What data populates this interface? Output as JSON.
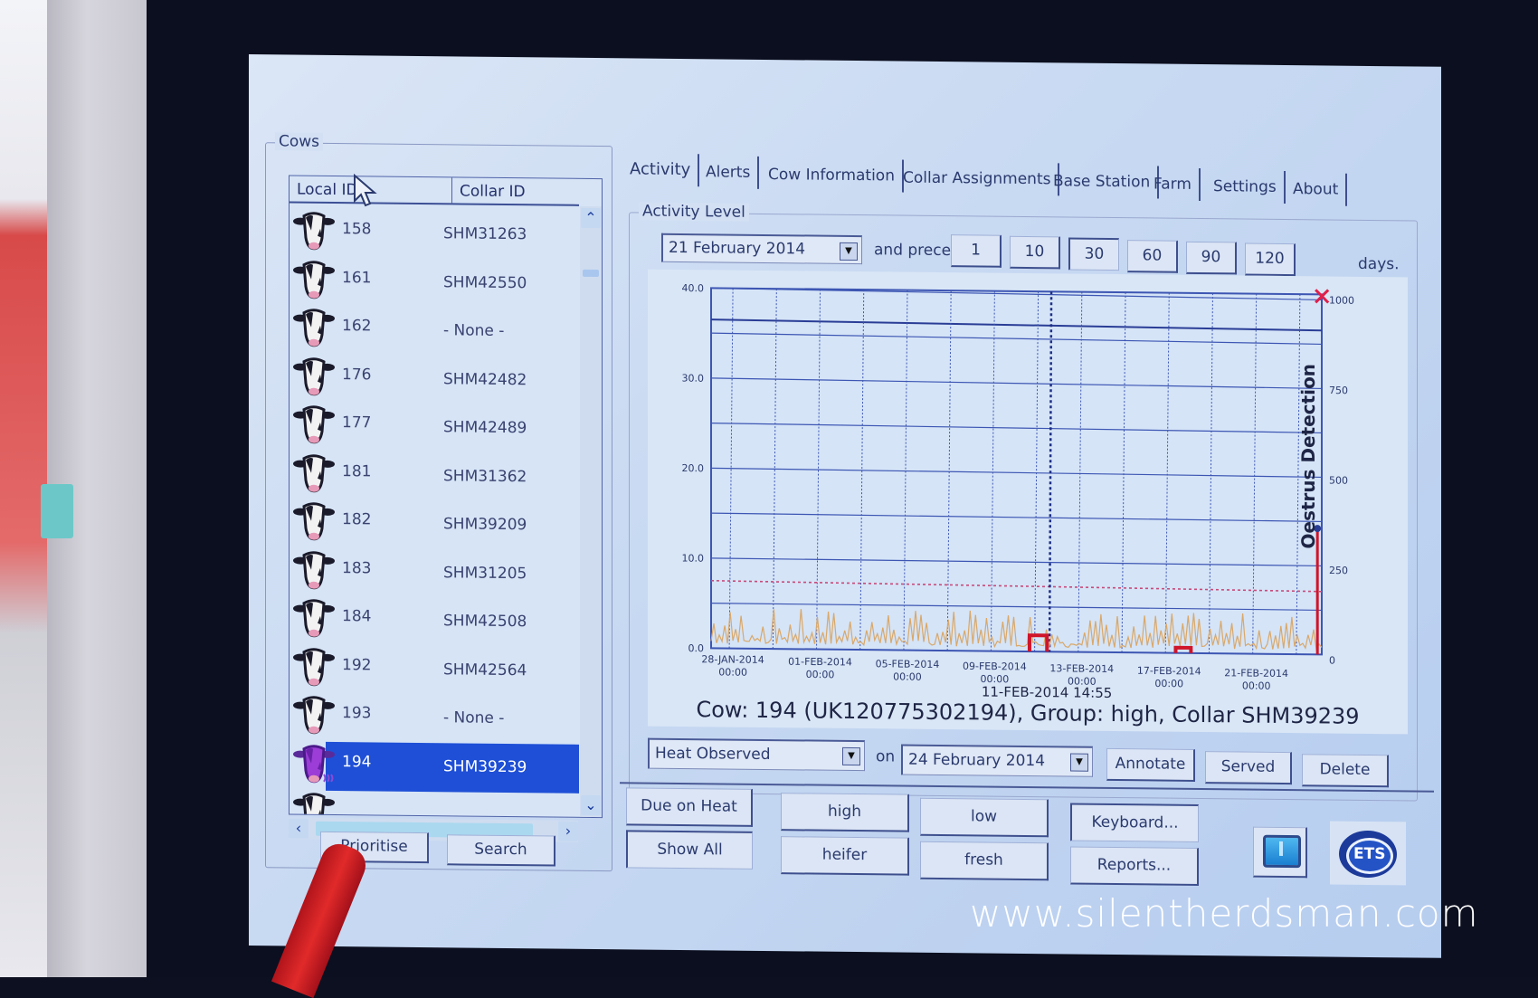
{
  "app": {
    "tabs": [
      {
        "label": "Activity",
        "active": true
      },
      {
        "label": "Alerts"
      },
      {
        "label": "Cow Information"
      },
      {
        "label": "Collar Assignments"
      },
      {
        "label": "Base Station"
      },
      {
        "label": "Farm"
      },
      {
        "label": "Settings"
      },
      {
        "label": "About"
      }
    ]
  },
  "cows_panel": {
    "title": "Cows",
    "columns": [
      "Local ID",
      "Collar ID"
    ],
    "rows": [
      {
        "local_id": "158",
        "collar_id": "SHM31263"
      },
      {
        "local_id": "161",
        "collar_id": "SHM42550"
      },
      {
        "local_id": "162",
        "collar_id": "- None -"
      },
      {
        "local_id": "176",
        "collar_id": "SHM42482"
      },
      {
        "local_id": "177",
        "collar_id": "SHM42489"
      },
      {
        "local_id": "181",
        "collar_id": "SHM31362"
      },
      {
        "local_id": "182",
        "collar_id": "SHM39209"
      },
      {
        "local_id": "183",
        "collar_id": "SHM31205"
      },
      {
        "local_id": "184",
        "collar_id": "SHM42508"
      },
      {
        "local_id": "192",
        "collar_id": "SHM42564"
      },
      {
        "local_id": "193",
        "collar_id": "- None -"
      },
      {
        "local_id": "194",
        "collar_id": "SHM39239",
        "selected": true,
        "in_heat": true
      }
    ],
    "buttons": {
      "prioritise": "Prioritise",
      "search": "Search"
    }
  },
  "activity": {
    "group_title": "Activity Level",
    "date_value": "21  February  2014",
    "and_preceding": "and preceding",
    "day_options": [
      "1",
      "10",
      "30",
      "60",
      "90",
      "120"
    ],
    "selected_days": "30",
    "days_label": "days.",
    "cursor_label": "11-FEB-2014 14:55",
    "cow_info": "Cow: 194 (UK120775302194), Group: high, Collar SHM39239",
    "event_value": "Heat Observed",
    "on_label": "on",
    "event_date": "24  February  2014",
    "buttons": {
      "annotate": "Annotate",
      "served": "Served",
      "delete": "Delete"
    }
  },
  "filters": {
    "due_on_heat": "Due on Heat",
    "show_all": "Show All",
    "high": "high",
    "heifer": "heifer",
    "low": "low",
    "fresh": "fresh",
    "keyboard": "Keyboard...",
    "reports": "Reports..."
  },
  "logo": {
    "text": "ETS"
  },
  "watermark": "www.silentherdsman.com",
  "colors": {
    "selection": "#1e4fd6",
    "activity_line": "#d9a86a",
    "heat_marker": "#d0142a",
    "threshold": "#c84a7a",
    "grid": "#3d56b3"
  },
  "chart_data": {
    "type": "line",
    "title": "",
    "ylabel_left": "",
    "ylabel_right": "Oestrus Detection",
    "ylim_left": [
      0,
      40
    ],
    "yticks_left": [
      "0.0",
      "10.0",
      "20.0",
      "30.0",
      "40.0"
    ],
    "ylim_right": [
      0,
      1000
    ],
    "yticks_right": [
      "0",
      "250",
      "500",
      "750",
      "1000"
    ],
    "xlim": [
      "27-JAN-2014",
      "24-FEB-2014"
    ],
    "xtick_labels": [
      {
        "date": "28-JAN-2014",
        "time": "00:00"
      },
      {
        "date": "01-FEB-2014",
        "time": "00:00"
      },
      {
        "date": "05-FEB-2014",
        "time": "00:00"
      },
      {
        "date": "09-FEB-2014",
        "time": "00:00"
      },
      {
        "date": "13-FEB-2014",
        "time": "00:00"
      },
      {
        "date": "17-FEB-2014",
        "time": "00:00"
      },
      {
        "date": "21-FEB-2014",
        "time": "00:00"
      }
    ],
    "grid": true,
    "threshold_level": 7.5,
    "cursor_date": "11-FEB-2014 14:55",
    "series": [
      {
        "name": "activity",
        "type": "spiky-line",
        "typical_range": [
          0.5,
          4.5
        ],
        "peak_max": 4.8
      },
      {
        "name": "heat_episodes",
        "type": "blocks",
        "episodes": [
          {
            "start_day": 14.6,
            "end_day": 15.4,
            "level": 1.8
          },
          {
            "start_day": 21.3,
            "end_day": 22.0,
            "level": 0.6
          }
        ]
      },
      {
        "name": "oestrus_detection",
        "type": "spike",
        "day": 27.8,
        "value": 350,
        "max_marker": 1000
      }
    ]
  }
}
